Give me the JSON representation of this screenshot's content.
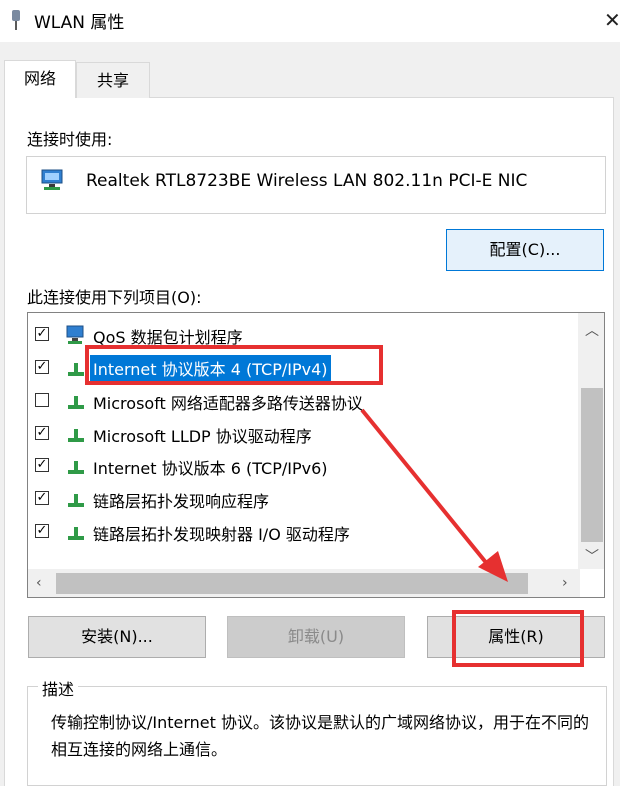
{
  "window": {
    "title": "WLAN 属性",
    "close_symbol": "✕"
  },
  "tabs": [
    {
      "label": "网络",
      "active": true
    },
    {
      "label": "共享",
      "active": false
    }
  ],
  "connect_using": {
    "label": "连接时使用:",
    "adapter_name": "Realtek RTL8723BE Wireless LAN 802.11n PCI-E NIC",
    "configure_label": "配置(C)..."
  },
  "items_section": {
    "label": "此连接使用下列项目(O):",
    "items": [
      {
        "text": "QoS 数据包计划程序",
        "checked": true,
        "icon": "network-scheduler-icon"
      },
      {
        "text": "Internet 协议版本 4 (TCP/IPv4)",
        "checked": true,
        "icon": "protocol-icon",
        "selected": true
      },
      {
        "text": "Microsoft 网络适配器多路传送器协议",
        "checked": false,
        "icon": "protocol-icon"
      },
      {
        "text": "Microsoft LLDP 协议驱动程序",
        "checked": true,
        "icon": "protocol-icon"
      },
      {
        "text": "Internet 协议版本 6 (TCP/IPv6)",
        "checked": true,
        "icon": "protocol-icon"
      },
      {
        "text": "链路层拓扑发现响应程序",
        "checked": true,
        "icon": "protocol-icon"
      },
      {
        "text": "链路层拓扑发现映射器 I/O 驱动程序",
        "checked": true,
        "icon": "protocol-icon"
      }
    ]
  },
  "buttons": {
    "install": "安装(N)...",
    "uninstall": "卸载(U)",
    "properties": "属性(R)"
  },
  "description": {
    "legend": "描述",
    "text": "传输控制协议/Internet 协议。该协议是默认的广域网络协议，用于在不同的相互连接的网络上通信。"
  },
  "colors": {
    "selection": "#0078d7",
    "annotation": "#e63030",
    "accent_border": "#0078d7"
  }
}
